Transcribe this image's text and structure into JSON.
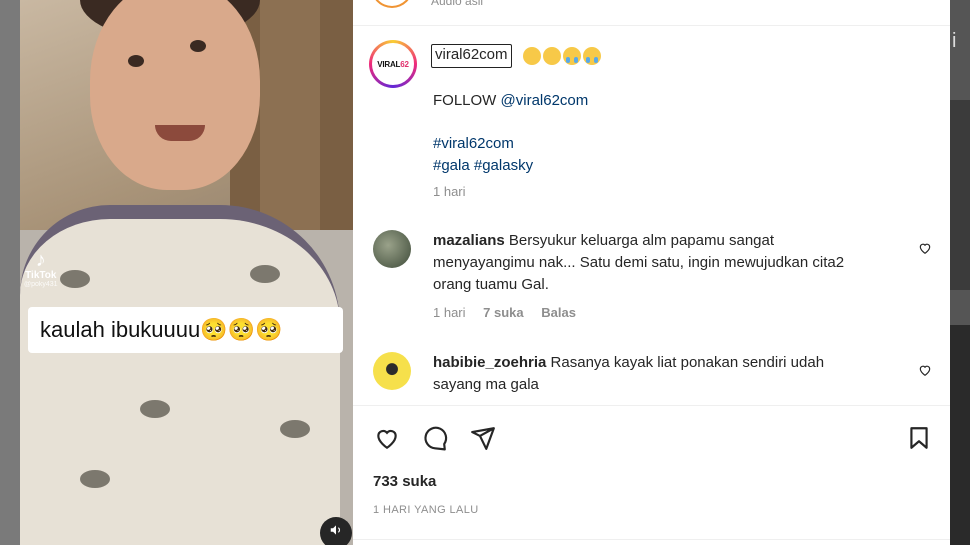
{
  "top_strip": {
    "text": "Audio asli"
  },
  "media": {
    "tiktok_label": "TikTok",
    "tiktok_handle": "@poky431",
    "caption": "kaulah ibukuuuu🥺🥺🥺",
    "volume_icon": "speaker-icon"
  },
  "post": {
    "avatar_text_a": "VIRAL",
    "avatar_text_b": "62",
    "username": "viral62com",
    "title_emojis": [
      "sad-face",
      "sad-face",
      "crying-face",
      "crying-face"
    ],
    "follow_prefix": "FOLLOW",
    "follow_link": "@viral62com",
    "hashtag_line1": "#viral62com",
    "hashtag_line2a": "#gala",
    "hashtag_line2b": "#galasky",
    "time": "1 hari"
  },
  "comments": [
    {
      "username": "mazalians",
      "text_line1": "Bersyukur keluarga alm papamu sangat",
      "text_line2": "menyayangimu nak... Satu demi satu, ingin mewujudkan cita2",
      "text_line3": "orang tuamu Gal.",
      "time": "1 hari",
      "likes": "7 suka",
      "reply": "Balas"
    },
    {
      "username": "habibie_zoehria",
      "text_line1": "Rasanya kayak liat ponakan sendiri udah",
      "text_line2": "sayang ma gala"
    }
  ],
  "footer": {
    "likes": "733 suka",
    "ago": "1 HARI YANG LALU"
  },
  "colors": {
    "link": "#00376b",
    "muted": "#8e8e8e",
    "text": "#262626"
  }
}
